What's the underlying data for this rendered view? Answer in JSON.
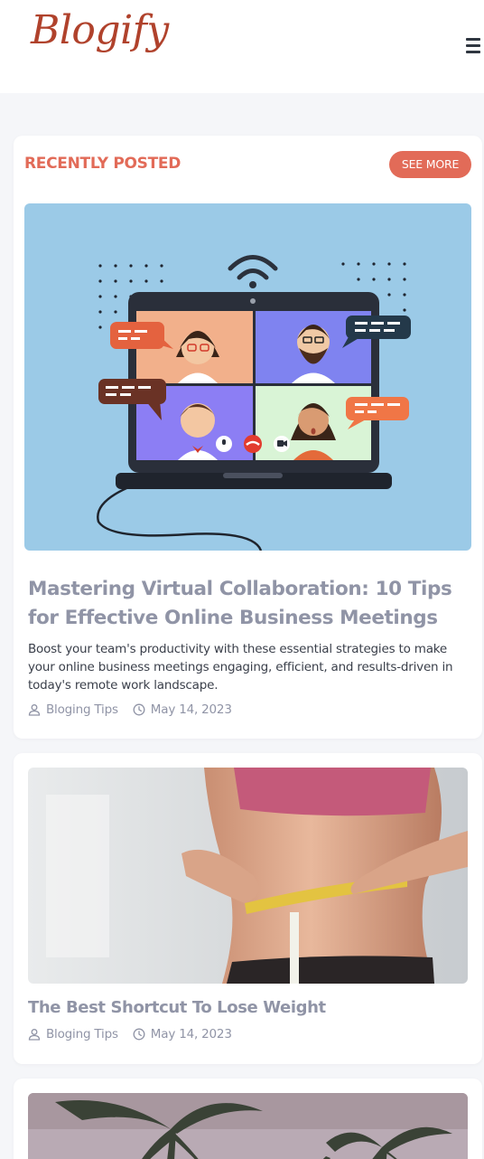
{
  "brand": {
    "name": "Blogify"
  },
  "section": {
    "title": "RECENTLY POSTED",
    "see_more": "SEE MORE"
  },
  "posts": [
    {
      "title": "Mastering Virtual Collaboration: 10 Tips for Effective Online Business Meetings",
      "excerpt": "Boost your team's productivity with these essential strategies to make your online business meetings engaging, efficient, and results-driven in today's remote work landscape.",
      "category": "Bloging Tips",
      "date": "May 14, 2023"
    },
    {
      "title": "The Best Shortcut To Lose Weight",
      "category": "Bloging Tips",
      "date": "May 14, 2023"
    }
  ],
  "colors": {
    "accent": "#e26b58",
    "logo": "#b0422c",
    "muted": "#9094a6",
    "hero_bg": "#9bcae7"
  },
  "icons": {
    "menu": "hamburger-icon",
    "author": "user-icon",
    "time": "clock-icon"
  }
}
